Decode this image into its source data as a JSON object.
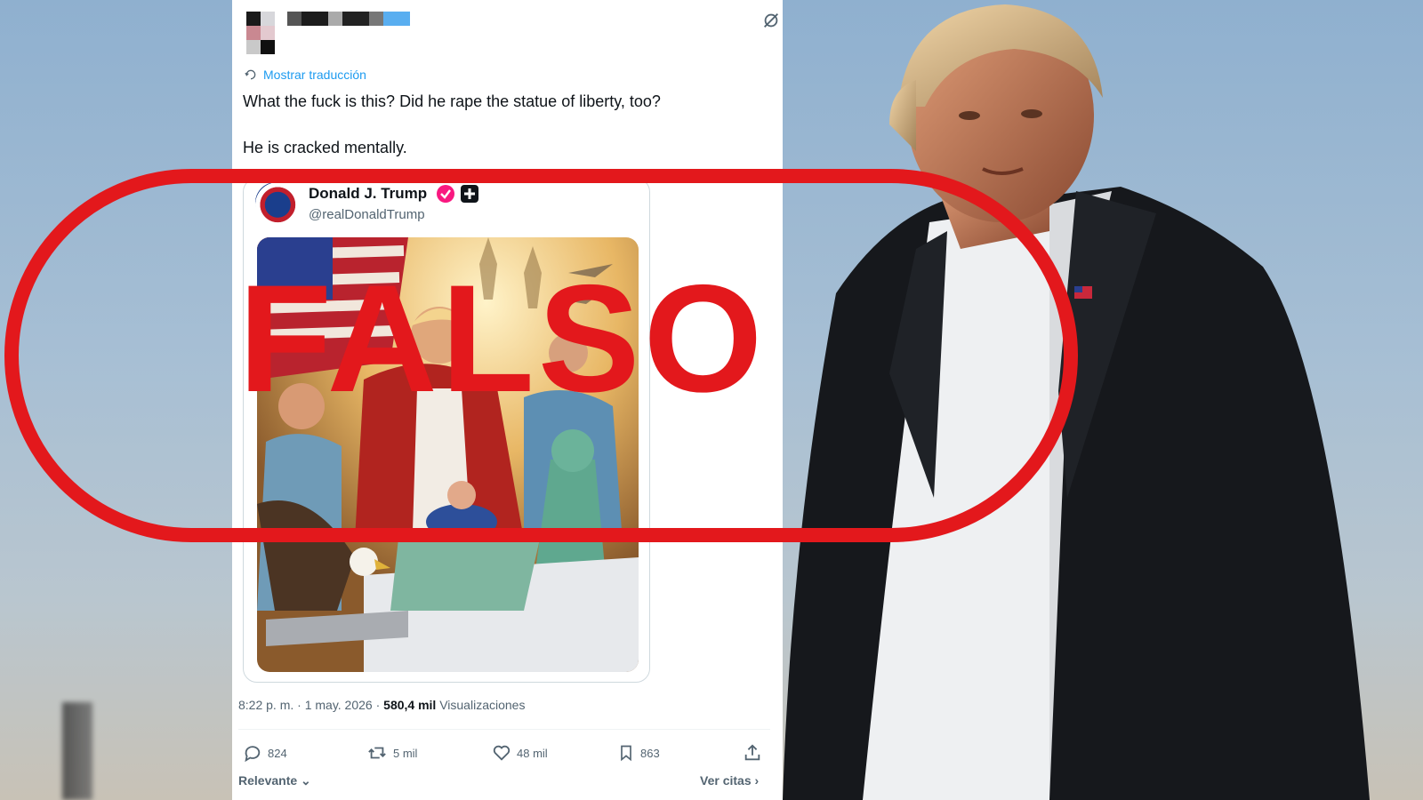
{
  "tweet": {
    "translate_label": "Mostrar traducción",
    "text_line1": "What the fuck is this? Did he rape the statue of liberty, too?",
    "text_line2": "He is cracked mentally.",
    "quote": {
      "name": "Donald J. Trump",
      "handle": "@realDonaldTrump"
    },
    "meta": {
      "time": "8:22 p. m. · 1 may. 2026 · ",
      "views_count": "580,4 mil",
      "views_label": " Visualizaciones"
    },
    "actions": {
      "replies": "824",
      "retweets": "5 mil",
      "likes": "48 mil",
      "bookmarks": "863"
    },
    "bottom": {
      "relevant": "Relevante",
      "quotes": "Ver citas"
    }
  },
  "stamp": {
    "word": "FALSO",
    "color": "#e3181c"
  },
  "colors": {
    "link": "#1d9bf0",
    "verified": "#f91880"
  },
  "icons": [
    "sync-icon",
    "translate-icon",
    "verified-icon",
    "plus-badge-icon",
    "reply-icon",
    "retweet-icon",
    "like-icon",
    "bookmark-icon",
    "share-icon",
    "chevron-down-icon",
    "chevron-right-icon"
  ]
}
